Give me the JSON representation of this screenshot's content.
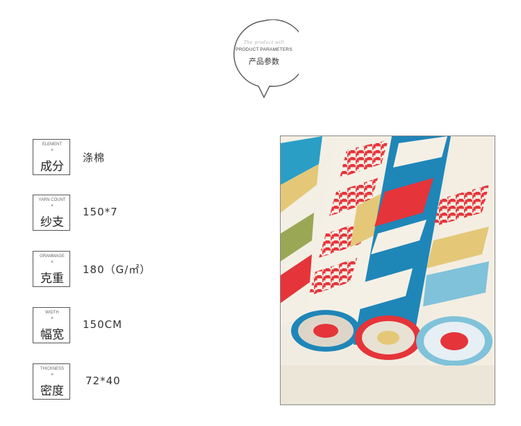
{
  "header": {
    "script_text": "The product will",
    "title_en": "PRODUCT PARAMETERS",
    "title_cn": "产品参数"
  },
  "params": [
    {
      "label_en": "ELEMENT",
      "label_x": "×",
      "label_cn": "成分",
      "value": "涤棉"
    },
    {
      "label_en": "YARN COUNT",
      "label_x": "×",
      "label_cn": "纱支",
      "value": "150*7"
    },
    {
      "label_en": "GRAMMAGE",
      "label_x": "×",
      "label_cn": "克重",
      "value": "180（G/㎡）"
    },
    {
      "label_en": "WIDTH",
      "label_x": "×",
      "label_cn": "幅宽",
      "value": "150CM"
    },
    {
      "label_en": "THICKNESS",
      "label_x": "×",
      "label_cn": "密度",
      "value": "72*40"
    }
  ],
  "photo": {
    "subject": "rolled-printed-fabric",
    "colors": {
      "blue": "#1f86b8",
      "red": "#e5343a",
      "cream": "#f3ede0",
      "yellow": "#e4c878",
      "olive": "#8a9a3c",
      "teal": "#2b9ec6"
    }
  }
}
